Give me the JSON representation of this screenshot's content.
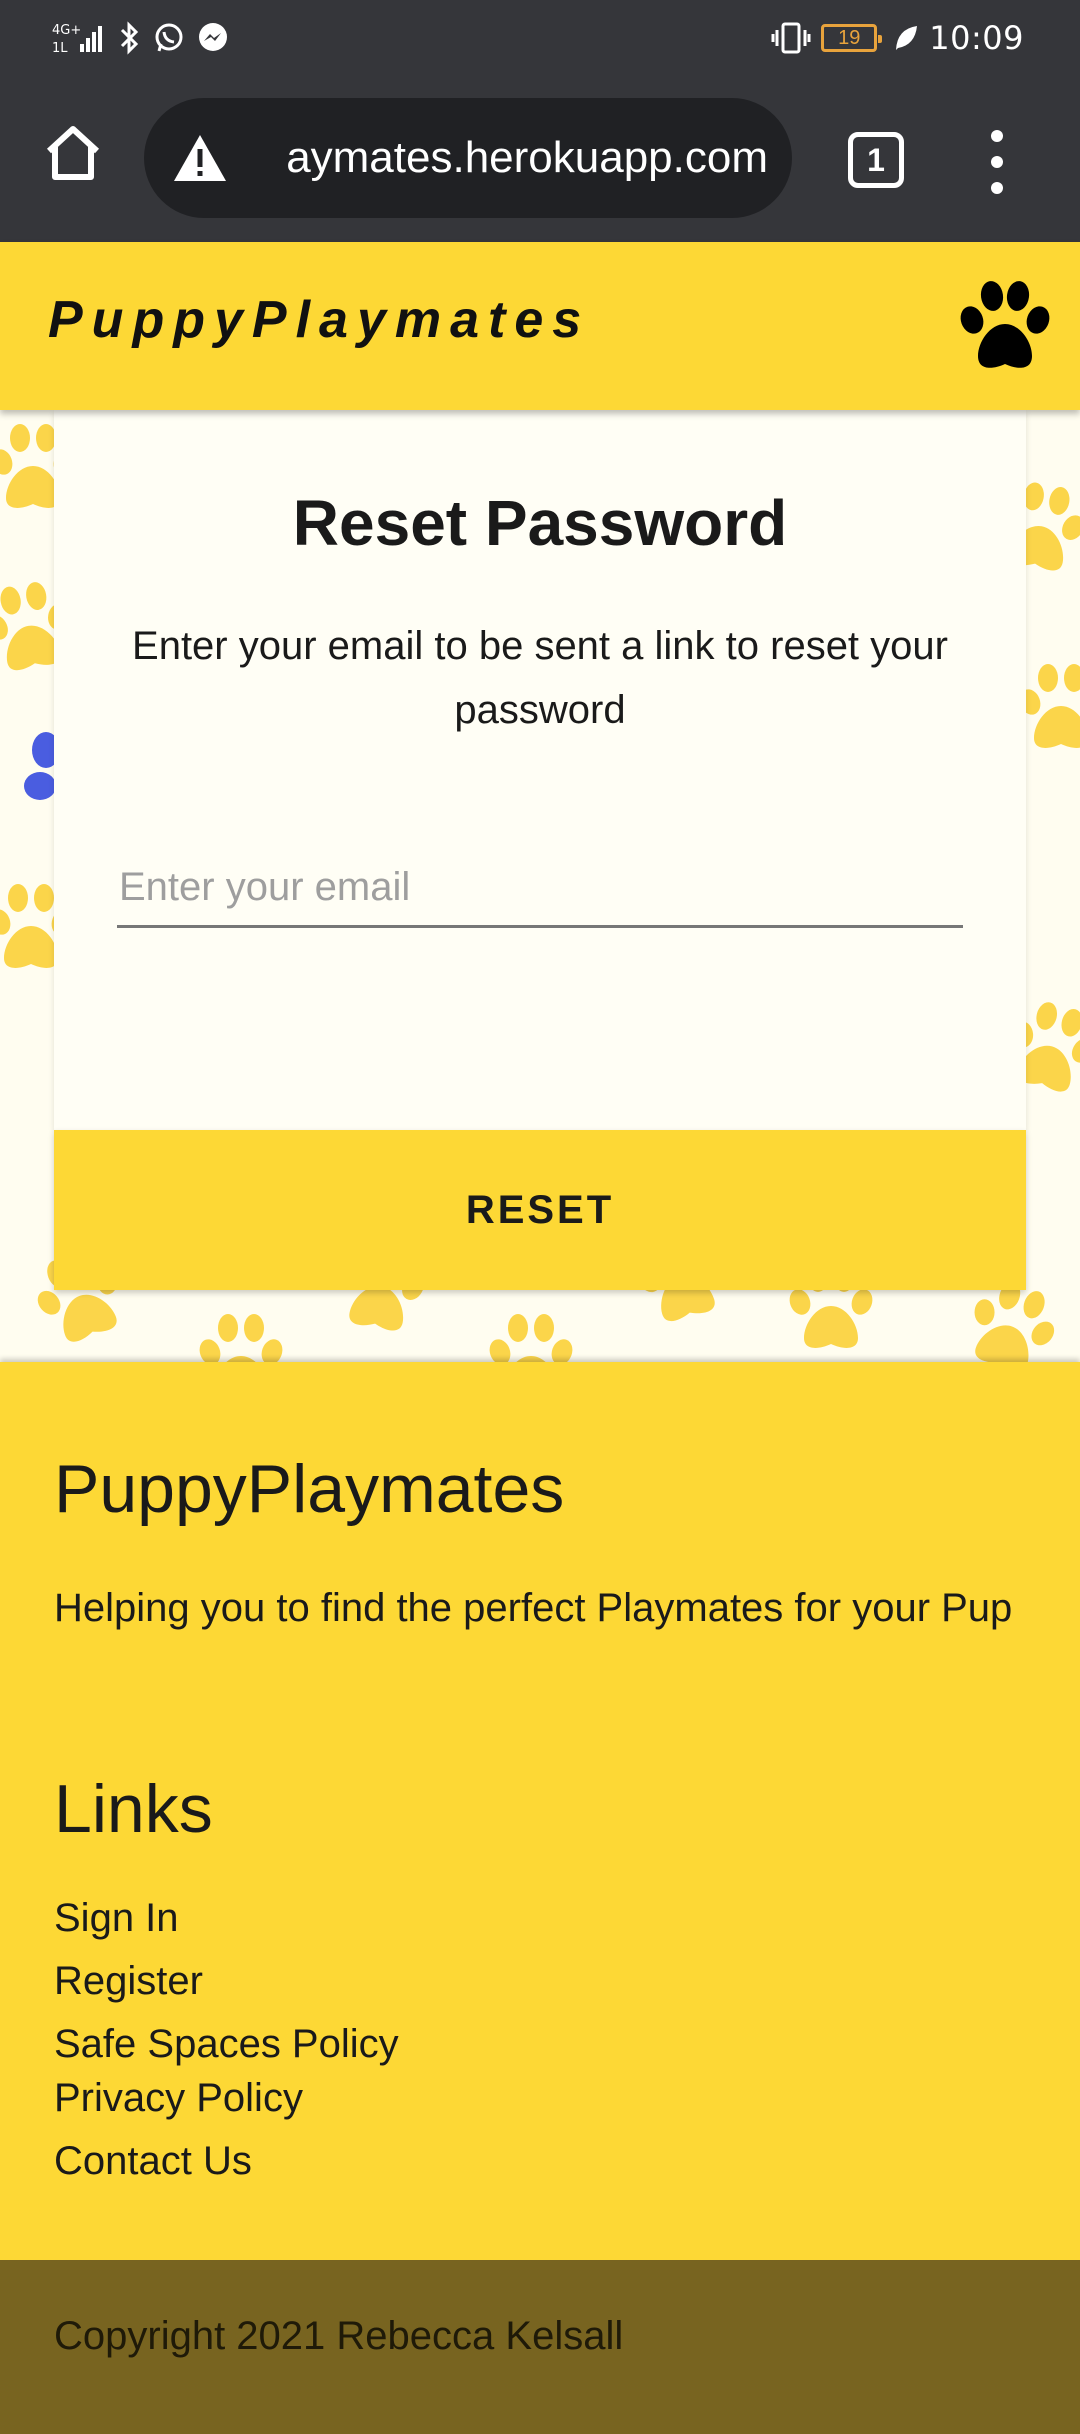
{
  "status_bar": {
    "time": "10:09",
    "battery": "19",
    "icons": [
      "network-4g-icon",
      "bluetooth-icon",
      "whatsapp-icon",
      "messenger-icon",
      "vibrate-icon",
      "battery-icon",
      "leaf-icon"
    ]
  },
  "browser": {
    "url": "aymates.herokuapp.com",
    "tab_count": "1",
    "icons": [
      "home-icon",
      "warning-icon",
      "tab-switcher-icon",
      "menu-dots-icon"
    ]
  },
  "navbar": {
    "brand": "PuppyPlaymates",
    "logo_icon": "paw-icon"
  },
  "reset_card": {
    "title": "Reset Password",
    "description": "Enter your email to be sent a link to reset your password",
    "email_placeholder": "Enter your email",
    "email_value": "",
    "button_label": "RESET"
  },
  "footer": {
    "title": "PuppyPlaymates",
    "tagline": "Helping you to find the perfect Playmates for your Pup",
    "links_title": "Links",
    "links": [
      "Sign In",
      "Register",
      "Safe Spaces Policy",
      "Privacy Policy",
      "Contact Us"
    ],
    "copyright": "Copyright 2021 Rebecca Kelsall"
  },
  "colors": {
    "brand_yellow": "#fdd835",
    "dark_chrome": "#35363a",
    "copyright_bg": "#786420",
    "background_paw": "#fbd54a"
  }
}
